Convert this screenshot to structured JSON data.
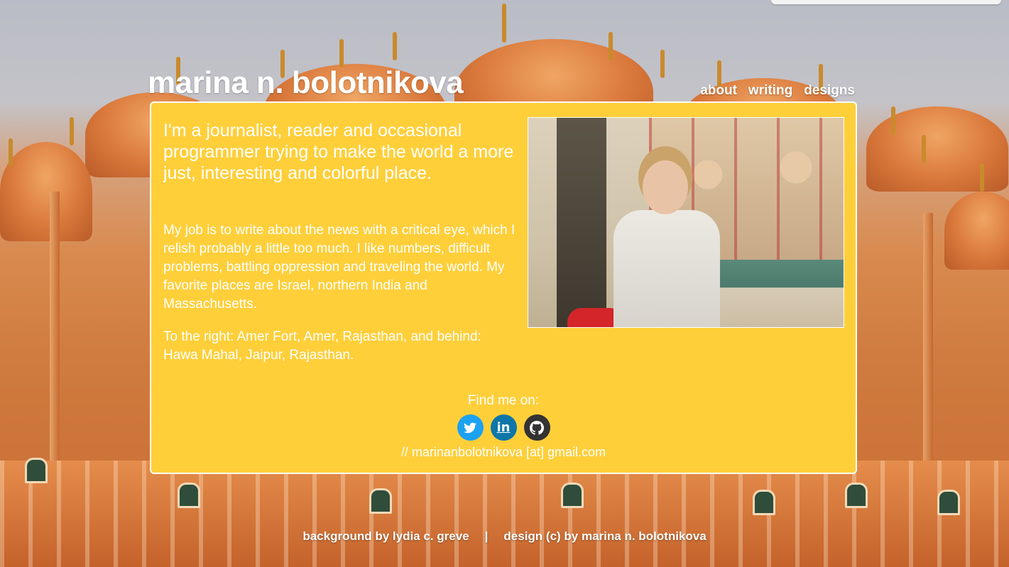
{
  "header": {
    "title": "marina n. bolotnikova",
    "nav": [
      {
        "label": "about"
      },
      {
        "label": "writing"
      },
      {
        "label": "designs"
      }
    ]
  },
  "main": {
    "intro": "I'm a journalist, reader and occasional programmer trying to make the world a more just, interesting and colorful place.",
    "paragraph1": "My job is to write about the news with a critical eye, which I relish probably a little too much. I like numbers, difficult problems, battling oppression and traveling the world. My favorite places are Israel, northern India and Massachusetts.",
    "paragraph2": "To the right: Amer Fort, Amer, Rajasthan, and behind: Hawa Mahal, Jaipur, Rajasthan.",
    "find_label": "Find me on:",
    "social": [
      {
        "name": "twitter-icon",
        "glyph": "🐦",
        "color": "#1da1f2"
      },
      {
        "name": "linkedin-icon",
        "glyph": "in",
        "color": "#0e76a8"
      },
      {
        "name": "github-icon",
        "glyph": "◉",
        "color": "#333333"
      }
    ],
    "email": "// marinanbolotnikova [at] gmail.com"
  },
  "footer": {
    "credit_background": "background by lydia c. greve",
    "separator": "|",
    "credit_design": "design (c) by marina n. bolotnikova"
  },
  "colors": {
    "card": "#ffcf3a",
    "text": "#ffffff"
  }
}
